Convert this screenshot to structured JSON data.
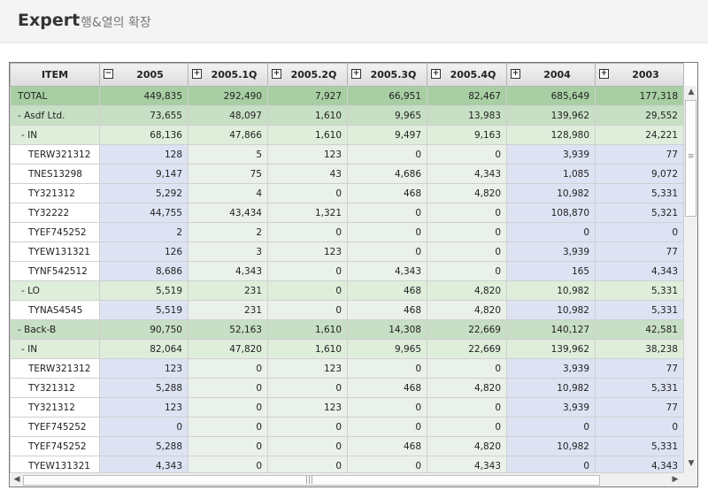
{
  "header": {
    "title": "Expert",
    "subtitle": "행&열의 확장"
  },
  "grid": {
    "columns": [
      {
        "label": "ITEM",
        "toggle": ""
      },
      {
        "label": "2005",
        "toggle": "−"
      },
      {
        "label": "2005.1Q",
        "toggle": "+"
      },
      {
        "label": "2005.2Q",
        "toggle": "+"
      },
      {
        "label": "2005.3Q",
        "toggle": "+"
      },
      {
        "label": "2005.4Q",
        "toggle": "+"
      },
      {
        "label": "2004",
        "toggle": "+"
      },
      {
        "label": "2003",
        "toggle": "+"
      }
    ],
    "rows": [
      {
        "kind": "total",
        "item": "TOTAL",
        "values": [
          "449,835",
          "292,490",
          "7,927",
          "66,951",
          "82,467",
          "685,649",
          "177,318"
        ]
      },
      {
        "kind": "group1",
        "item": "- Asdf Ltd.",
        "values": [
          "73,655",
          "48,097",
          "1,610",
          "9,965",
          "13,983",
          "139,962",
          "29,552"
        ]
      },
      {
        "kind": "group2",
        "item": "- IN",
        "values": [
          "68,136",
          "47,866",
          "1,610",
          "9,497",
          "9,163",
          "128,980",
          "24,221"
        ]
      },
      {
        "kind": "leaf",
        "item": "TERW321312",
        "values": [
          "128",
          "5",
          "123",
          "0",
          "0",
          "3,939",
          "77"
        ]
      },
      {
        "kind": "leaf",
        "item": "TNES13298",
        "values": [
          "9,147",
          "75",
          "43",
          "4,686",
          "4,343",
          "1,085",
          "9,072"
        ]
      },
      {
        "kind": "leaf",
        "item": "TY321312",
        "values": [
          "5,292",
          "4",
          "0",
          "468",
          "4,820",
          "10,982",
          "5,331"
        ]
      },
      {
        "kind": "leaf",
        "item": "TY32222",
        "values": [
          "44,755",
          "43,434",
          "1,321",
          "0",
          "0",
          "108,870",
          "5,321"
        ]
      },
      {
        "kind": "leaf",
        "item": "TYEF745252",
        "values": [
          "2",
          "2",
          "0",
          "0",
          "0",
          "0",
          "0"
        ]
      },
      {
        "kind": "leaf",
        "item": "TYEW131321",
        "values": [
          "126",
          "3",
          "123",
          "0",
          "0",
          "3,939",
          "77"
        ]
      },
      {
        "kind": "leaf",
        "item": "TYNF542512",
        "values": [
          "8,686",
          "4,343",
          "0",
          "4,343",
          "0",
          "165",
          "4,343"
        ]
      },
      {
        "kind": "group2",
        "item": "- LO",
        "values": [
          "5,519",
          "231",
          "0",
          "468",
          "4,820",
          "10,982",
          "5,331"
        ]
      },
      {
        "kind": "leaf",
        "item": "TYNAS4545",
        "values": [
          "5,519",
          "231",
          "0",
          "468",
          "4,820",
          "10,982",
          "5,331"
        ]
      },
      {
        "kind": "group1",
        "item": "- Back-B",
        "values": [
          "90,750",
          "52,163",
          "1,610",
          "14,308",
          "22,669",
          "140,127",
          "42,581"
        ]
      },
      {
        "kind": "group2",
        "item": "- IN",
        "values": [
          "82,064",
          "47,820",
          "1,610",
          "9,965",
          "22,669",
          "139,962",
          "38,238"
        ]
      },
      {
        "kind": "leaf",
        "item": "TERW321312",
        "values": [
          "123",
          "0",
          "123",
          "0",
          "0",
          "3,939",
          "77"
        ]
      },
      {
        "kind": "leaf",
        "item": "TY321312",
        "values": [
          "5,288",
          "0",
          "0",
          "468",
          "4,820",
          "10,982",
          "5,331"
        ]
      },
      {
        "kind": "leaf",
        "item": "TY321312",
        "values": [
          "123",
          "0",
          "123",
          "0",
          "0",
          "3,939",
          "77"
        ]
      },
      {
        "kind": "leaf",
        "item": "TYEF745252",
        "values": [
          "0",
          "0",
          "0",
          "0",
          "0",
          "0",
          "0"
        ]
      },
      {
        "kind": "leaf",
        "item": "TYEF745252",
        "values": [
          "5,288",
          "0",
          "0",
          "468",
          "4,820",
          "10,982",
          "5,331"
        ]
      },
      {
        "kind": "leaf",
        "item": "TYEW131321",
        "values": [
          "4,343",
          "0",
          "0",
          "0",
          "4,343",
          "0",
          "4,343"
        ]
      }
    ]
  },
  "scrollbars": {
    "up": "▲",
    "down": "▼",
    "left": "◀",
    "right": "▶",
    "grip_v": "≡",
    "grip_h": "|||"
  },
  "colors": {
    "total": "#a7cfa3",
    "group1": "#c7dfc4",
    "group2": "#deeedb",
    "leaf": "#eaf0ea",
    "year_cells": "#dde3f3"
  }
}
